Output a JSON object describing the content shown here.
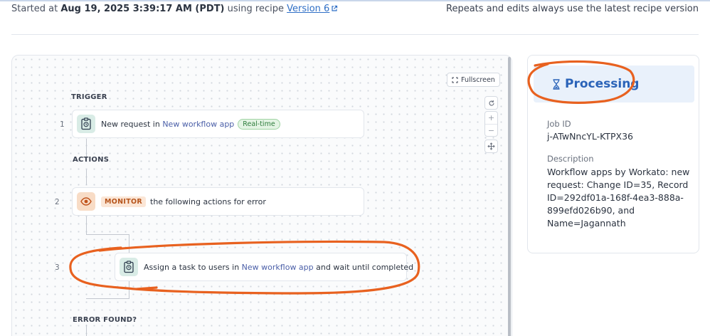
{
  "header": {
    "started_prefix": "Started at",
    "started_at": "Aug 19, 2025 3:39:17 AM (PDT)",
    "using_recipe": "using recipe",
    "version_link": "Version 6",
    "repeat_note": "Repeats and edits always use the latest recipe version"
  },
  "canvas": {
    "fullscreen_label": "Fullscreen",
    "trigger_label": "TRIGGER",
    "actions_label": "ACTIONS",
    "error_label": "ERROR FOUND?",
    "steps": [
      {
        "num": "1",
        "prefix": "New request in",
        "app": "New workflow app",
        "badge": "Real-time"
      },
      {
        "num": "2",
        "keyword": "MONITOR",
        "text": "the following actions for error"
      },
      {
        "num": "3",
        "prefix": "Assign a task to users in",
        "app": "New workflow app",
        "suffix": "and wait until completed"
      }
    ],
    "tools": [
      "refresh-icon",
      "zoom-in-icon",
      "zoom-out-icon",
      "recenter-icon"
    ]
  },
  "job": {
    "status": "Processing",
    "status_color": "#2a63b8",
    "job_id_label": "Job ID",
    "job_id": "j-ATwNncYL-KTPX36",
    "description_label": "Description",
    "description": "Workflow apps by Workato: new request: Change ID=35, Record ID=292df01a-168f-4ea3-888a-899efd026b90, and Name=Jagannath"
  },
  "annotation_color": "#e8611f"
}
